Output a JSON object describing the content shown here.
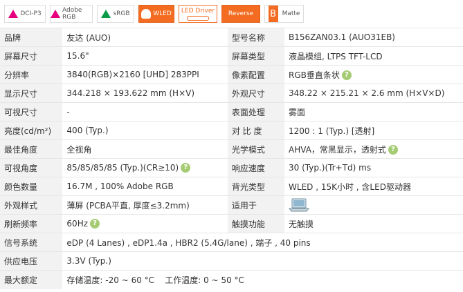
{
  "badges": [
    "DCI-P3",
    "Adobe RGB",
    "sRGB",
    "WLED",
    "LED Driver",
    "Reverse",
    "B",
    "Matte"
  ],
  "rows": [
    {
      "k1": "品牌",
      "v1": "友达 (AUO)",
      "k2": "型号名称",
      "v2": "B156ZAN03.1 (AUO31EB)"
    },
    {
      "k1": "屏幕尺寸",
      "v1": "15.6\"",
      "k2": "屏幕类型",
      "v2": "液晶模组,  LTPS TFT-LCD"
    },
    {
      "k1": "分辨率",
      "v1": "3840(RGB)×2160  [UHD]  283PPI",
      "k2": "像素配置",
      "v2": "RGB垂直条状"
    },
    {
      "k1": "显示尺寸",
      "v1": "344.218 × 193.622 mm (H×V)",
      "k2": "外观尺寸",
      "v2": "348.22 × 215.21 × 2.6 mm (H×V×D)"
    },
    {
      "k1": "可视尺寸",
      "v1": "-",
      "k2": "表面处理",
      "v2": "雾面"
    },
    {
      "k1": "亮度(cd/m²)",
      "v1": "400 (Typ.)",
      "k2": "对 比 度",
      "v2": "1200 : 1 (Typ.) [透射]"
    },
    {
      "k1": "最佳角度",
      "v1": "全视角",
      "k2": "光学模式",
      "v2": "AHVA，常黑显示，透射式"
    },
    {
      "k1": "可视角度",
      "v1": "85/85/85/85 (Typ.)(CR≥10)",
      "k2": "响应速度",
      "v2": "30 (Typ.)(Tr+Td) ms"
    },
    {
      "k1": "颜色数量",
      "v1": "16.7M , 100% Adobe RGB",
      "k2": "背光类型",
      "v2": "WLED , 15K小时 , 含LED驱动器"
    },
    {
      "k1": "外观样式",
      "v1": "薄屏 (PCBA平直, 厚度≤3.2mm)",
      "k2": "适用于",
      "v2": ""
    },
    {
      "k1": "刷新频率",
      "v1": "60Hz",
      "k2": "触摸功能",
      "v2": "无触摸"
    }
  ],
  "wide_rows": [
    {
      "k": "信号系统",
      "v": "eDP (4 Lanes) , eDP1.4a , HBR2 (5.4G/lane) , 端子 , 40 pins"
    },
    {
      "k": "供应电压",
      "v": "3.3V (Typ.)"
    },
    {
      "k": "最大额定",
      "v": "存储温度: -20 ~ 60 °C    工作温度: 0 ~ 50 °C"
    }
  ],
  "help_symbol": "?"
}
